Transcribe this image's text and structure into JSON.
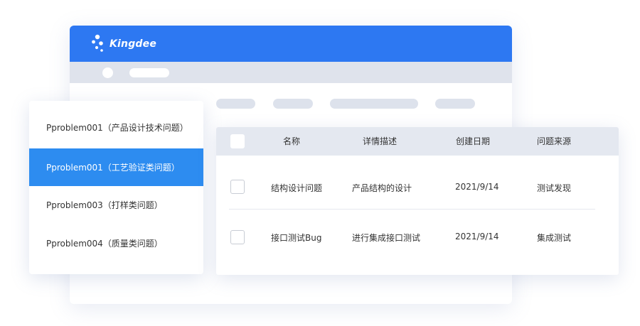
{
  "app": {
    "brand": "Kingdee"
  },
  "sidebar": {
    "items": [
      {
        "label": "Pproblem001（产品设计技术问题）",
        "active": false
      },
      {
        "label": "Pproblem001（工艺验证类问题）",
        "active": true
      },
      {
        "label": "Pproblem003（打样类问题）",
        "active": false
      },
      {
        "label": "Pproblem004（质量类问题）",
        "active": false
      }
    ]
  },
  "table": {
    "columns": [
      "名称",
      "详情描述",
      "创建日期",
      "问题来源"
    ],
    "rows": [
      {
        "name": "结构设计问题",
        "description": "产品结构的设计",
        "date": "2021/9/14",
        "source": "测试发现"
      },
      {
        "name": "接口测试Bug",
        "description": "进行集成接口测试",
        "date": "2021/9/14",
        "source": "集成测试"
      }
    ]
  },
  "colors": {
    "brand_blue": "#2d78f2",
    "active_item": "#2d8cf0",
    "header_gray": "#e4e8f0",
    "placeholder_gray": "#dde2ec"
  },
  "icons": {
    "logo": "kingdee-logo-icon"
  }
}
